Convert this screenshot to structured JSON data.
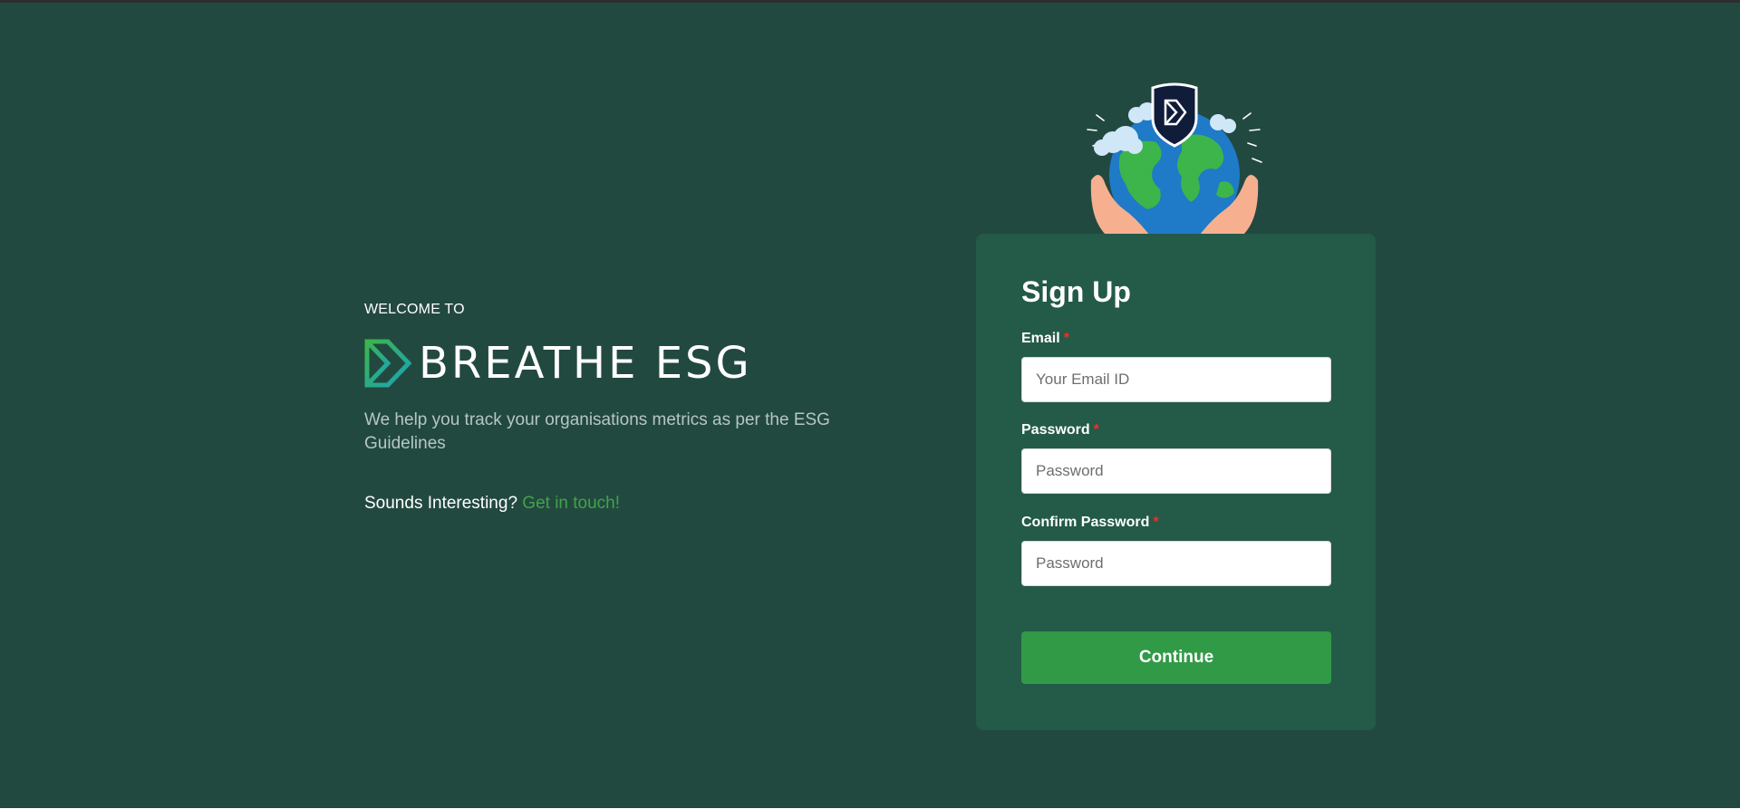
{
  "intro": {
    "welcome": "WELCOME TO",
    "brand_name": "BREATHE ESG",
    "tagline": "We help you track your organisations metrics as per the ESG Guidelines",
    "cta_text": "Sounds Interesting?",
    "cta_link": "Get in touch!"
  },
  "form": {
    "title": "Sign Up",
    "email_label": "Email",
    "email_placeholder": "Your Email ID",
    "password_label": "Password",
    "password_placeholder": "Password",
    "confirm_label": "Confirm Password",
    "confirm_placeholder": "Password",
    "required_marker": "*",
    "submit_label": "Continue"
  },
  "icons": {
    "brand_logo": "breathe-esg-logo-icon",
    "illustration": "globe-in-hands-icon"
  },
  "colors": {
    "background": "#224940",
    "card": "#245a48",
    "accent": "#309a46",
    "link": "#41a34a",
    "required": "#e3342f"
  }
}
